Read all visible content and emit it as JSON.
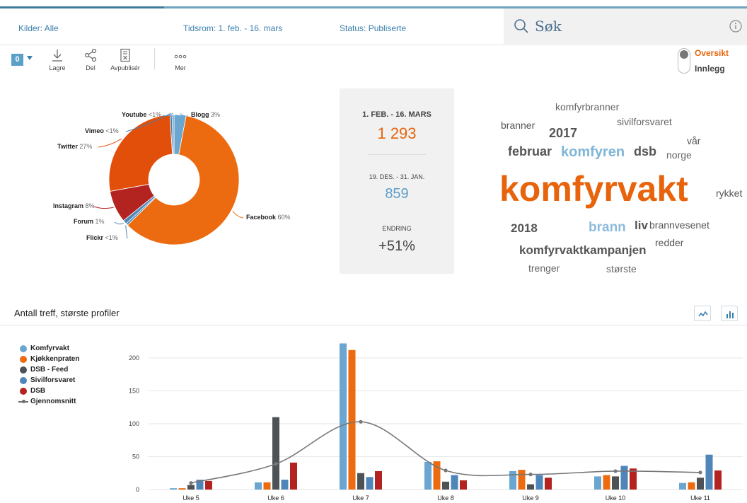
{
  "filters": {
    "sources": "Kilder: Alle",
    "period": "Tidsrom: 1. feb. - 16. mars",
    "status": "Status: Publiserte"
  },
  "search": {
    "label": "Søk"
  },
  "toolbar": {
    "count": "0",
    "save": "Lagre",
    "share": "Del",
    "unpublish": "Avpublisér",
    "more": "Mer"
  },
  "view": {
    "overview": "Oversikt",
    "posts": "Innlegg",
    "active": "overview"
  },
  "colors": {
    "accent_orange": "#e8640c",
    "accent_blue": "#5d9ec7",
    "toolbar_blue": "#3b7fae"
  },
  "donut": {
    "slices": [
      {
        "name": "Blogg",
        "percent_label": "3%",
        "value": 3,
        "color": "#6aa6cf"
      },
      {
        "name": "Facebook",
        "percent_label": "60%",
        "value": 60,
        "color": "#ec6b10"
      },
      {
        "name": "Flickr",
        "percent_label": "<1%",
        "value": 0.5,
        "color": "#4a86b4"
      },
      {
        "name": "Forum",
        "percent_label": "1%",
        "value": 1,
        "color": "#4f86ba"
      },
      {
        "name": "Instagram",
        "percent_label": "8%",
        "value": 8,
        "color": "#b3231f"
      },
      {
        "name": "Twitter",
        "percent_label": "27%",
        "value": 27,
        "color": "#e14f0b"
      },
      {
        "name": "Vimeo",
        "percent_label": "<1%",
        "value": 0.5,
        "color": "#4a7eaa"
      },
      {
        "name": "Youtube",
        "percent_label": "<1%",
        "value": 0.5,
        "color": "#5b9bcf"
      }
    ]
  },
  "stats": {
    "current_label": "1. FEB. - 16. MARS",
    "current_value": "1 293",
    "previous_label": "19. DES. - 31. JAN.",
    "previous_value": "859",
    "change_label": "ENDRING",
    "change_value": "+51%"
  },
  "word_cloud": [
    {
      "text": "komfyrbranner",
      "color": "#666",
      "weight": "normal"
    },
    {
      "text": "branner",
      "color": "#555",
      "weight": "normal"
    },
    {
      "text": "2017",
      "color": "#555",
      "weight": "bold"
    },
    {
      "text": "sivilforsvaret",
      "color": "#666",
      "weight": "normal"
    },
    {
      "text": "vår",
      "color": "#555",
      "weight": "normal"
    },
    {
      "text": "februar",
      "color": "#555",
      "weight": "bold"
    },
    {
      "text": "komfyren",
      "color": "#7fb6d8",
      "weight": "bold"
    },
    {
      "text": "dsb",
      "color": "#555",
      "weight": "bold"
    },
    {
      "text": "norge",
      "color": "#666",
      "weight": "normal"
    },
    {
      "text": "komfyrvakt",
      "color": "#e8640c",
      "weight": "bold"
    },
    {
      "text": "rykket",
      "color": "#555",
      "weight": "normal"
    },
    {
      "text": "2018",
      "color": "#555",
      "weight": "bold"
    },
    {
      "text": "brann",
      "color": "#8cbbdc",
      "weight": "bold"
    },
    {
      "text": "liv",
      "color": "#555",
      "weight": "bold"
    },
    {
      "text": "brannvesenet",
      "color": "#555",
      "weight": "normal"
    },
    {
      "text": "komfyrvaktkampanjen",
      "color": "#555",
      "weight": "bold"
    },
    {
      "text": "redder",
      "color": "#555",
      "weight": "normal"
    },
    {
      "text": "trenger",
      "color": "#666",
      "weight": "normal"
    },
    {
      "text": "største",
      "color": "#666",
      "weight": "normal"
    }
  ],
  "section": {
    "title": "Antall treff, største profiler"
  },
  "chart_data": {
    "type": "bar",
    "categories": [
      "Uke 5",
      "Uke 6",
      "Uke 7",
      "Uke 8",
      "Uke 9",
      "Uke 10",
      "Uke 11"
    ],
    "ylim": [
      0,
      230
    ],
    "yticks": [
      0,
      50,
      100,
      150,
      200
    ],
    "grid": true,
    "legend_placement": "left",
    "series": [
      {
        "name": "Komfyrvakt",
        "color": "#6aa6cf",
        "values": [
          2,
          11,
          222,
          42,
          28,
          20,
          10
        ]
      },
      {
        "name": "Kjøkkenpraten",
        "color": "#ec6b10",
        "values": [
          2,
          11,
          212,
          43,
          30,
          22,
          11
        ]
      },
      {
        "name": "DSB - Feed",
        "color": "#4d5257",
        "values": [
          7,
          110,
          25,
          12,
          8,
          20,
          18
        ]
      },
      {
        "name": "Sivilforsvaret",
        "color": "#4f86ba",
        "values": [
          15,
          15,
          19,
          22,
          22,
          36,
          53
        ]
      },
      {
        "name": "DSB",
        "color": "#b3231f",
        "values": [
          13,
          41,
          28,
          14,
          18,
          32,
          29
        ]
      }
    ],
    "line": {
      "name": "Gjennomsnitt",
      "color": "#777777",
      "values": [
        10,
        39,
        103,
        29,
        23,
        28,
        26
      ]
    }
  }
}
